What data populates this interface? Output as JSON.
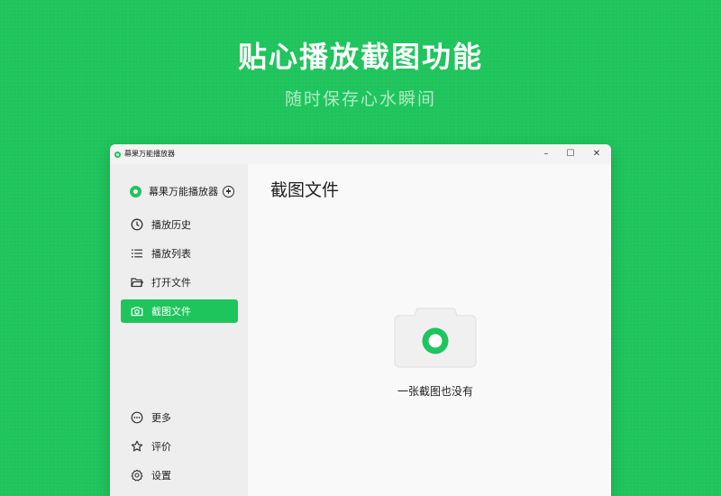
{
  "banner": {
    "headline": "贴心播放截图功能",
    "subline": "随时保存心水瞬间"
  },
  "window": {
    "title": "幕果万能播放器",
    "controls": {
      "minimize": "–",
      "maximize": "☐",
      "close": "✕"
    }
  },
  "sidebar": {
    "brand": "幕果万能播放器",
    "items": [
      {
        "label": "播放历史",
        "icon": "clock-icon"
      },
      {
        "label": "播放列表",
        "icon": "list-icon"
      },
      {
        "label": "打开文件",
        "icon": "folder-icon"
      },
      {
        "label": "截图文件",
        "icon": "camera-icon",
        "active": true
      }
    ],
    "bottom_items": [
      {
        "label": "更多",
        "icon": "more-icon"
      },
      {
        "label": "评价",
        "icon": "star-icon"
      },
      {
        "label": "设置",
        "icon": "gear-icon"
      }
    ]
  },
  "main": {
    "title": "截图文件",
    "empty_state": "一张截图也没有"
  },
  "colors": {
    "accent": "#1ec45c",
    "background": "#1ec45c"
  }
}
